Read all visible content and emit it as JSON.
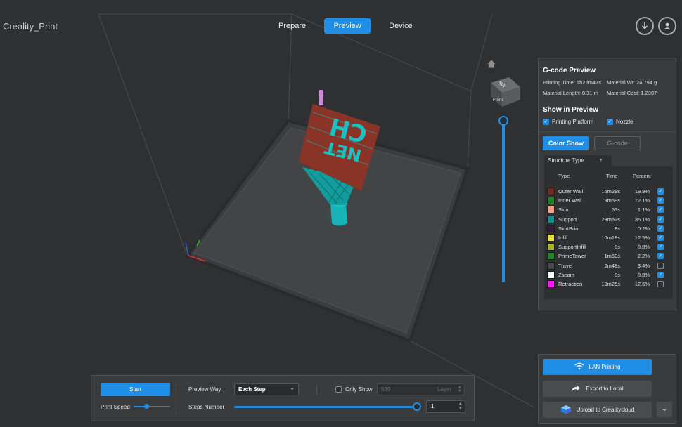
{
  "app": {
    "title": "Creality_Print"
  },
  "tabs": [
    {
      "label": "Prepare",
      "active": false
    },
    {
      "label": "Preview",
      "active": true
    },
    {
      "label": "Device",
      "active": false
    }
  ],
  "header_icons": [
    "download-icon",
    "user-icon"
  ],
  "viewcube": {
    "top_label": "Top",
    "front_label": "Front"
  },
  "model_text": {
    "line1": "CH",
    "line2": "NET"
  },
  "gcode_preview": {
    "title": "G-code Preview",
    "printing_time": "Printing Time: 1h22m47s",
    "material_wt": "Material Wt: 24.794 g",
    "material_length": "Material Length: 8.31 m",
    "material_cost": "Material Cost: 1.2397"
  },
  "show_in_preview": {
    "title": "Show in Preview",
    "printing_platform": {
      "label": "Printing Platform",
      "checked": true
    },
    "nozzle": {
      "label": "Nozzle",
      "checked": true
    }
  },
  "color_show_button": "Color Show",
  "gcode_button": "G-code",
  "structure_type": {
    "label": "Structure Type",
    "headers": {
      "type": "Type",
      "time": "Time",
      "percent": "Percent"
    },
    "rows": [
      {
        "color": "#6e2b22",
        "name": "Outer Wall",
        "time": "16m29s",
        "percent": "19.9%",
        "checked": true
      },
      {
        "color": "#0f8a17",
        "name": "Inner Wall",
        "time": "9m59s",
        "percent": "12.1%",
        "checked": true
      },
      {
        "color": "#f2a07e",
        "name": "Skin",
        "time": "53s",
        "percent": "1.1%",
        "checked": true
      },
      {
        "color": "#0f8f8f",
        "name": "Support",
        "time": "29m52s",
        "percent": "36.1%",
        "checked": true
      },
      {
        "color": "#3b1a3f",
        "name": "SkirtBrim",
        "time": "8s",
        "percent": "0.2%",
        "checked": true
      },
      {
        "color": "#e2e22a",
        "name": "Infill",
        "time": "10m18s",
        "percent": "12.5%",
        "checked": true
      },
      {
        "color": "#a9b51b",
        "name": "SupportInfill",
        "time": "0s",
        "percent": "0.0%",
        "checked": true
      },
      {
        "color": "#1e8a26",
        "name": "PrimeTower",
        "time": "1m50s",
        "percent": "2.2%",
        "checked": true
      },
      {
        "color": "#4a4a4a",
        "name": "Travel",
        "time": "2m48s",
        "percent": "3.4%",
        "checked": false
      },
      {
        "color": "#ffffff",
        "name": "Zseam",
        "time": "0s",
        "percent": "0.0%",
        "checked": true
      },
      {
        "color": "#ff18ff",
        "name": "Retraction",
        "time": "10m25s",
        "percent": "12.6%",
        "checked": false
      }
    ]
  },
  "playback": {
    "start_label": "Start",
    "print_speed_label": "Print Speed",
    "preview_way_label": "Preview Way",
    "preview_way_value": "Each Step",
    "only_show_label": "Only Show",
    "only_show_checked": false,
    "layer_value": "589",
    "layer_unit": "Layer",
    "steps_number_label": "Steps Number",
    "steps_value": "1"
  },
  "actions": {
    "lan_printing": "LAN Printing",
    "export_local": "Export to Local",
    "upload_cloud": "Upload to Crealitycloud"
  },
  "colors": {
    "accent": "#1f8ee6",
    "background": "#2f3032",
    "panel": "#3a3b3d"
  }
}
